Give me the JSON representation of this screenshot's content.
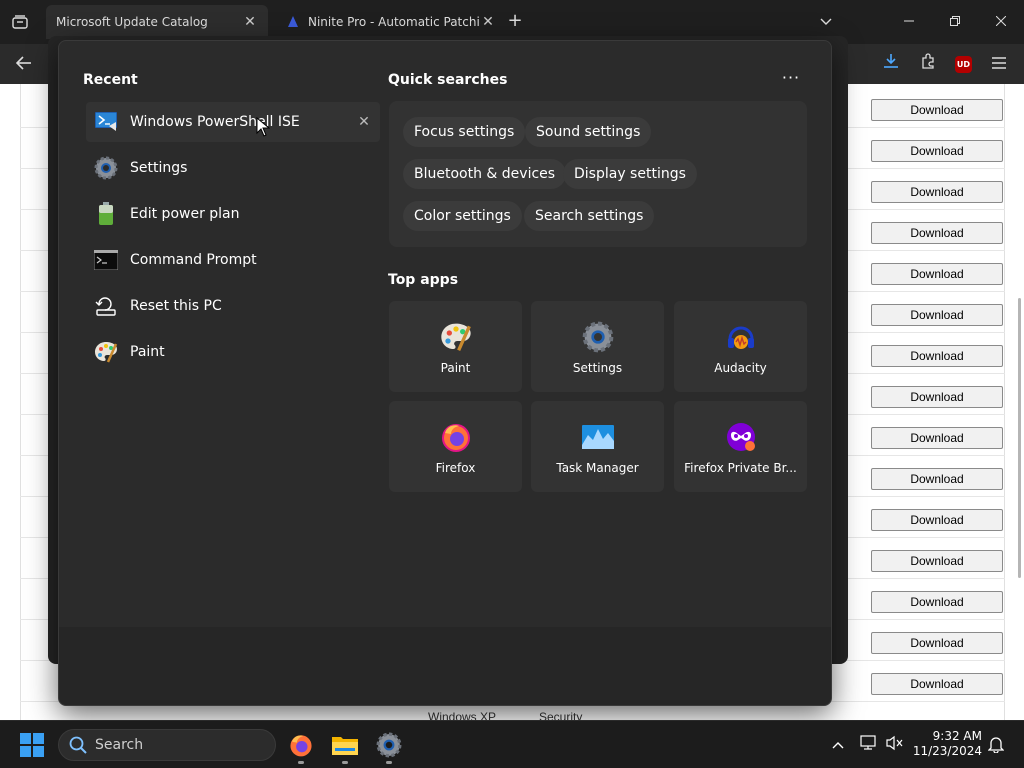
{
  "browser": {
    "tabs": [
      {
        "title": "Microsoft Update Catalog",
        "active": true
      },
      {
        "title": "Ninite Pro - Automatic Patching",
        "active": false
      }
    ],
    "close_glyph": "✕",
    "new_tab_glyph": "+",
    "ublock_badge": "UD"
  },
  "page": {
    "download_label": "Download",
    "peek": [
      "Windows XP",
      "Security"
    ]
  },
  "menu": {
    "recent_title": "Recent",
    "recent": [
      {
        "label": "Windows PowerShell ISE",
        "icon": "powershell-ise-icon"
      },
      {
        "label": "Settings",
        "icon": "settings-gear-icon"
      },
      {
        "label": "Edit power plan",
        "icon": "battery-icon"
      },
      {
        "label": "Command Prompt",
        "icon": "command-prompt-icon"
      },
      {
        "label": "Reset this PC",
        "icon": "reset-pc-icon"
      },
      {
        "label": "Paint",
        "icon": "paint-palette-icon"
      }
    ],
    "quick_searches_title": "Quick searches",
    "more_glyph": "···",
    "quick_searches": [
      "Focus settings",
      "Sound settings",
      "Bluetooth & devices",
      "Display settings",
      "Color settings",
      "Search settings"
    ],
    "top_apps_title": "Top apps",
    "top_apps": [
      {
        "label": "Paint",
        "icon": "paint-palette-icon"
      },
      {
        "label": "Settings",
        "icon": "settings-gear-icon"
      },
      {
        "label": "Audacity",
        "icon": "audacity-icon"
      },
      {
        "label": "Firefox",
        "icon": "firefox-icon"
      },
      {
        "label": "Task Manager",
        "icon": "task-manager-icon"
      },
      {
        "label": "Firefox Private Br...",
        "icon": "firefox-private-icon"
      }
    ]
  },
  "taskbar": {
    "search_placeholder": "Search",
    "time": "9:32 AM",
    "date": "11/23/2024"
  },
  "colors": {
    "accent": "#0078d4",
    "menu_bg": "#2b2b2b"
  }
}
